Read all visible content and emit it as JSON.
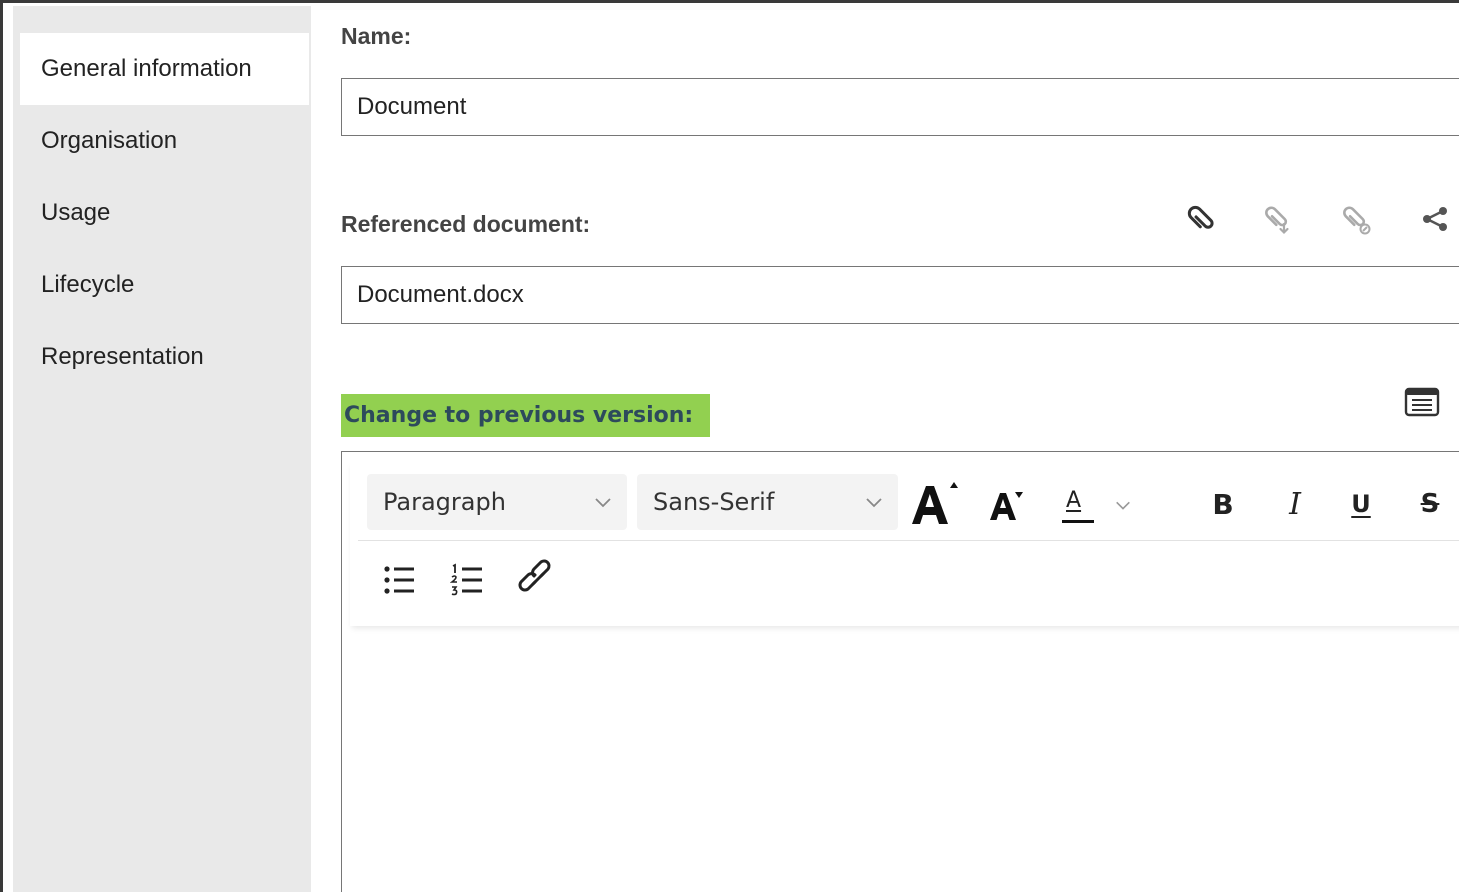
{
  "sidebar": {
    "items": [
      {
        "label": "General information",
        "active": true
      },
      {
        "label": "Organisation",
        "active": false
      },
      {
        "label": "Usage",
        "active": false
      },
      {
        "label": "Lifecycle",
        "active": false
      },
      {
        "label": "Representation",
        "active": false
      }
    ]
  },
  "name_field": {
    "label": "Name:",
    "value": "Document"
  },
  "referenced_document": {
    "label": "Referenced document:",
    "value": "Document.docx",
    "icons": [
      "attach-icon",
      "download-attachment-icon",
      "remove-attachment-icon",
      "share-icon"
    ]
  },
  "change_section": {
    "label": "Change to previous version:",
    "highlight_color": "#92d050",
    "label_color": "#2d4a5c"
  },
  "editor": {
    "toolbar": {
      "block_format": "Paragraph",
      "font_family": "Sans-Serif",
      "font_color_letter": "A"
    },
    "content": ""
  }
}
